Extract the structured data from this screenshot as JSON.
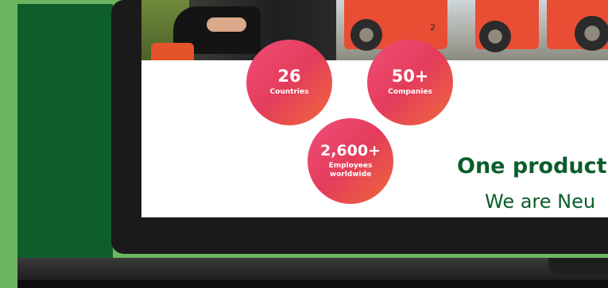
{
  "stats": {
    "countries": {
      "value": "26",
      "label": "Countries"
    },
    "companies": {
      "value": "50+",
      "label": "Companies"
    },
    "employees": {
      "value": "2,600+",
      "label": "Employees\nworldwide"
    }
  },
  "headline": "One product",
  "subline": "We are Neu",
  "photo": {
    "truck_number": "2"
  },
  "colors": {
    "brand_green": "#0b5d2b",
    "bubble_pink": "#e43c5b",
    "bubble_orange": "#ef6a3a",
    "page_green": "#6db562"
  }
}
